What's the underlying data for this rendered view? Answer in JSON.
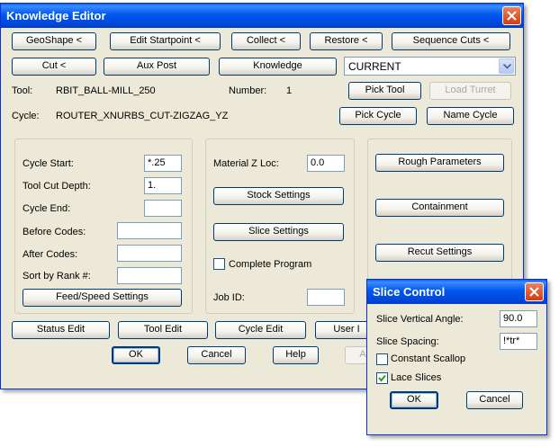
{
  "main_window": {
    "title": "Knowledge Editor",
    "row1_buttons": [
      "GeoShape <",
      "Edit Startpoint <",
      "Collect <",
      "Restore <",
      "Sequence Cuts <"
    ],
    "row2_buttons": [
      "Cut <",
      "Aux Post",
      "Knowledge"
    ],
    "current_select": "CURRENT",
    "tool_label": "Tool:",
    "tool_value": "RBIT_BALL-MILL_250",
    "number_label": "Number:",
    "number_value": "1",
    "pick_tool": "Pick Tool",
    "load_turret": "Load Turret",
    "cycle_label": "Cycle:",
    "cycle_value": "ROUTER_XNURBS_CUT-ZIGZAG_YZ",
    "pick_cycle": "Pick Cycle",
    "name_cycle": "Name Cycle",
    "left_group": {
      "cycle_start_label": "Cycle Start:",
      "cycle_start_value": "*.25",
      "tool_cut_depth_label": "Tool Cut Depth:",
      "tool_cut_depth_value": "1.",
      "cycle_end_label": "Cycle End:",
      "cycle_end_value": "",
      "before_codes_label": "Before Codes:",
      "before_codes_value": "",
      "after_codes_label": "After Codes:",
      "after_codes_value": "",
      "sort_by_rank_label": "Sort by Rank #:",
      "sort_by_rank_value": "",
      "feed_speed_button": "Feed/Speed Settings"
    },
    "mid_group": {
      "material_z_label": "Material Z Loc:",
      "material_z_value": "0.0",
      "stock_settings": "Stock Settings",
      "slice_settings": "Slice Settings",
      "complete_program": "Complete Program",
      "job_id_label": "Job ID:",
      "job_id_value": ""
    },
    "right_group": {
      "rough_parameters": "Rough Parameters",
      "containment": "Containment",
      "recut_settings": "Recut Settings"
    },
    "bottom_row": [
      "Status Edit",
      "Tool Edit",
      "Cycle Edit",
      "User I"
    ],
    "ok": "OK",
    "cancel": "Cancel",
    "help": "Help",
    "apply_partial": "A"
  },
  "slice_dialog": {
    "title": "Slice Control",
    "vertical_angle_label": "Slice Vertical Angle:",
    "vertical_angle_value": "90.0",
    "spacing_label": "Slice Spacing:",
    "spacing_value": "!*tr*",
    "constant_scallop": "Constant Scallop",
    "constant_scallop_checked": false,
    "lace_slices": "Lace Slices",
    "lace_slices_checked": true,
    "ok": "OK",
    "cancel": "Cancel"
  }
}
